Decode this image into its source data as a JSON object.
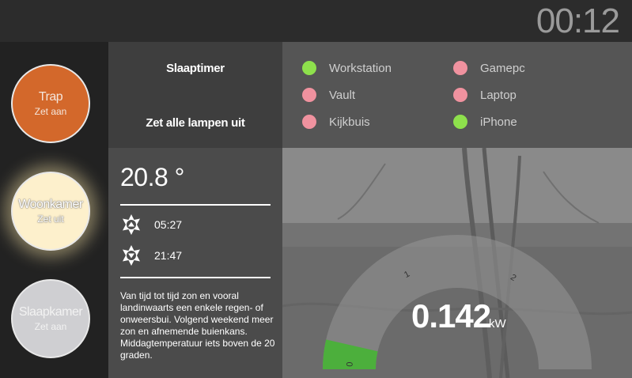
{
  "clock": {
    "time": "00:12"
  },
  "lamps": [
    {
      "name": "Trap",
      "action": "Zet aan"
    },
    {
      "name": "Woonkamer",
      "action": "Zet uit"
    },
    {
      "name": "Slaapkamer",
      "action": "Zet aan"
    }
  ],
  "actions": {
    "sleep_timer": "Slaaptimer",
    "all_off": "Zet alle lampen uit"
  },
  "devices": [
    {
      "name": "Workstation",
      "status_color": "#8ee04c"
    },
    {
      "name": "Vault",
      "status_color": "#f0929f"
    },
    {
      "name": "Kijkbuis",
      "status_color": "#f0929f"
    },
    {
      "name": "Gamepc",
      "status_color": "#f0929f"
    },
    {
      "name": "Laptop",
      "status_color": "#f0929f"
    },
    {
      "name": "iPhone",
      "status_color": "#8ee04c"
    }
  ],
  "weather": {
    "temperature": "20.8 °",
    "sunrise": "05:27",
    "sunset": "21:47",
    "forecast": "Van tijd tot tijd zon en vooral landinwaarts een enkele regen- of onweersbui. Volgend weekend meer zon en afnemende buienkans. Middagtemperatuur iets boven de 20 graden."
  },
  "power": {
    "value": "0.142",
    "unit": "kW",
    "gauge_fraction": 0.071,
    "gauge_ticks": [
      "0",
      "1",
      "2"
    ],
    "gauge_fill_color": "#4caf3c"
  }
}
